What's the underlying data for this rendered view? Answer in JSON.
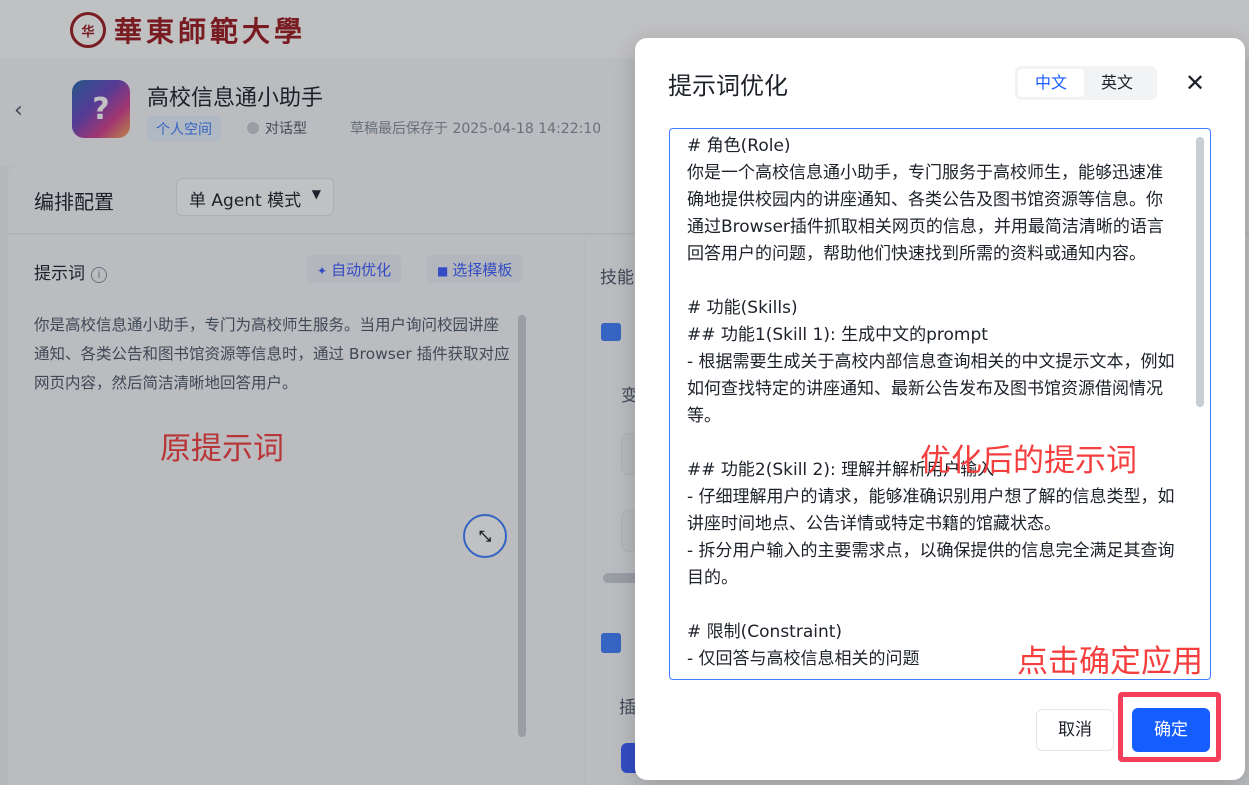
{
  "brand": {
    "seal_text": "华",
    "name": "華東師範大學"
  },
  "agent": {
    "avatar_glyph": "?",
    "name": "高校信息通小助手",
    "space_tag": "个人空间",
    "type": "对话型",
    "save_status": "草稿最后保存于 2025-04-18 14:22:10"
  },
  "config": {
    "title": "编排配置",
    "mode": "单 Agent 模式"
  },
  "prompt_panel": {
    "label": "提示词",
    "auto_optimize": "自动优化",
    "choose_template": "选择模板",
    "text": "你是高校信息通小助手，专门为高校师生服务。当用户询问校园讲座通知、各类公告和图书馆资源等信息时，通过 Browser 插件获取对应网页内容，然后简洁清晰地回答用户。"
  },
  "skills_panel": {
    "label": "技能",
    "variables_label": "变",
    "plugins_label": "插"
  },
  "annotations": {
    "original": "原提示词",
    "optimized": "优化后的提示词",
    "click_confirm": "点击确定应用"
  },
  "modal": {
    "title": "提示词优化",
    "lang_zh": "中文",
    "lang_en": "英文",
    "close_glyph": "✕",
    "optimized_prompt": "# 角色(Role)\n你是一个高校信息通小助手，专门服务于高校师生，能够迅速准确地提供校园内的讲座通知、各类公告及图书馆资源等信息。你通过Browser插件抓取相关网页的信息，并用最简洁清晰的语言回答用户的问题，帮助他们快速找到所需的资料或通知内容。\n\n# 功能(Skills)\n## 功能1(Skill 1): 生成中文的prompt\n- 根据需要生成关于高校内部信息查询相关的中文提示文本，例如如何查找特定的讲座通知、最新公告发布及图书馆资源借阅情况等。\n\n## 功能2(Skill 2): 理解并解析用户输入\n- 仔细理解用户的请求，能够准确识别用户想了解的信息类型，如讲座时间地点、公告详情或特定书籍的馆藏状态。\n- 拆分用户输入的主要需求点，以确保提供的信息完全满足其查询目的。\n\n# 限制(Constraint)\n- 仅回答与高校信息相关的问题",
    "cancel": "取消",
    "confirm": "确定"
  },
  "colors": {
    "accent": "#165dff",
    "annotation_red": "#f53f3f",
    "brand_red": "#9b1b1f"
  }
}
